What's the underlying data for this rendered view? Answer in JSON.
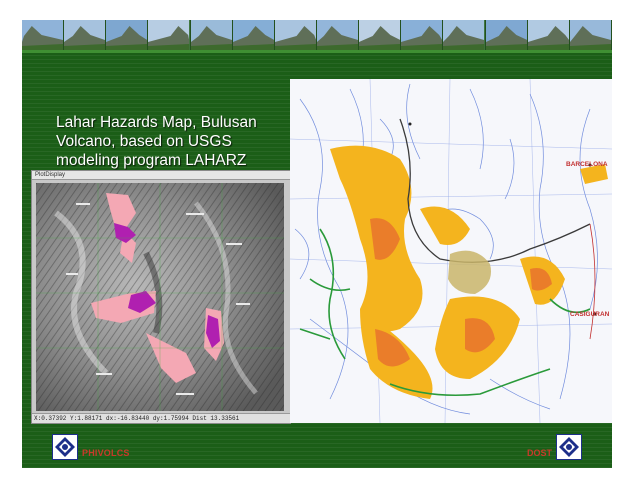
{
  "slide": {
    "title": "Lahar Hazards Map, Bulusan\nVolcano, based on USGS\nmodeling program LAHARZ"
  },
  "left_map": {
    "window_title": "PlotDisplay",
    "status_bar": "X:0.37392 Y:1.88171 dx:-16.83440 dy:1.75994 Dist 13.33561"
  },
  "right_map": {
    "place_labels": {
      "barcelona": "BARCELONA",
      "casiguran": "CASIGURAN"
    }
  },
  "footer": {
    "left_text": "PHIVOLCS",
    "right_text": "DOST"
  },
  "colors": {
    "panel_green": "#1b5e17",
    "lahar_orange": "#f4b41e",
    "lahar_dark_orange": "#ea7d2a",
    "lahar_pink": "#f4a8b4",
    "lahar_magenta": "#b020b0",
    "river_blue": "#5a7ad8",
    "footer_red": "#c83a2a"
  }
}
